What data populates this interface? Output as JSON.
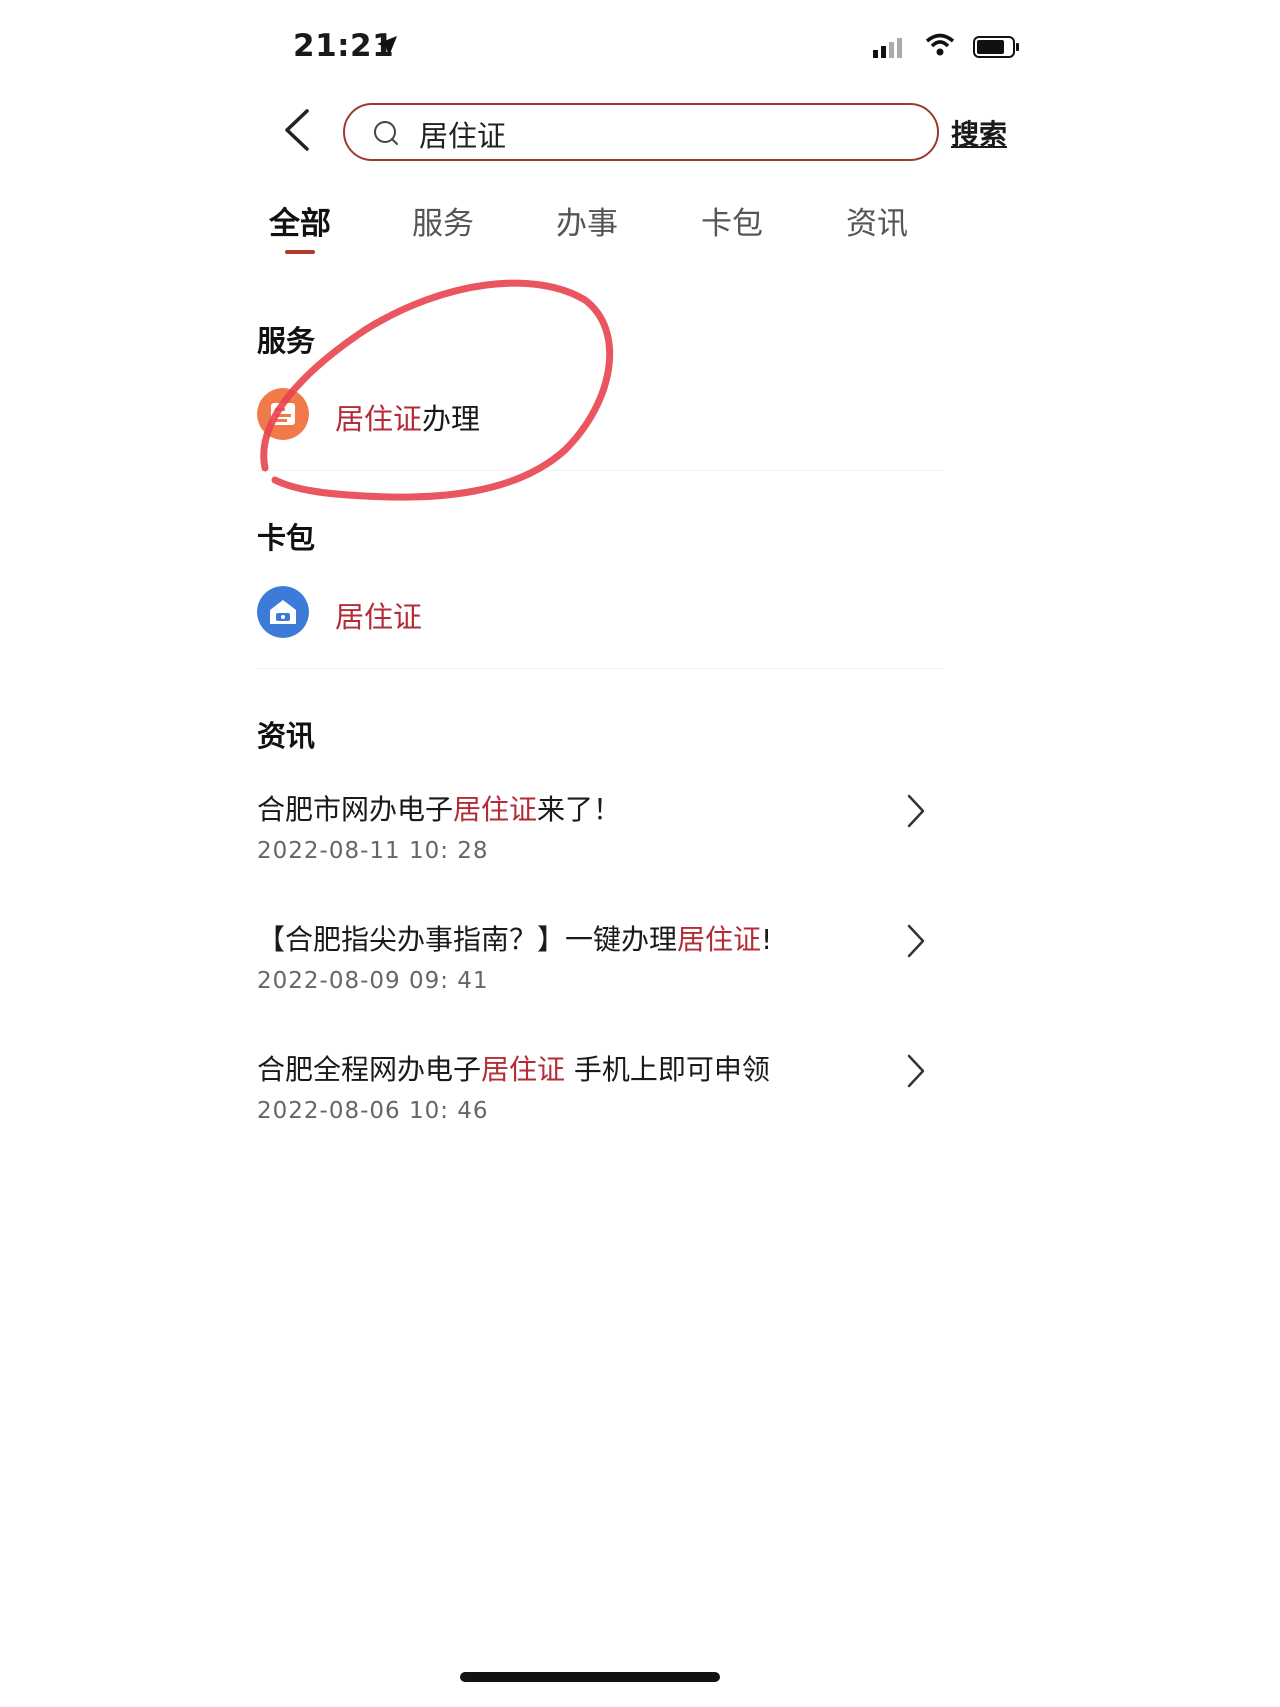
{
  "status_bar": {
    "time": "21:21"
  },
  "search": {
    "query": "居住证",
    "button_label": "搜索"
  },
  "tabs": [
    {
      "label": "全部",
      "active": true
    },
    {
      "label": "服务",
      "active": false
    },
    {
      "label": "办事",
      "active": false
    },
    {
      "label": "卡包",
      "active": false
    },
    {
      "label": "资讯",
      "active": false
    }
  ],
  "services": {
    "title": "服务",
    "item": {
      "highlight": "居住证",
      "rest": "办理",
      "icon": "document-icon"
    }
  },
  "cards": {
    "title": "卡包",
    "item": {
      "highlight": "居住证",
      "icon": "house-card-icon"
    }
  },
  "news": {
    "title": "资讯",
    "items": [
      {
        "pre": "合肥市网办电子",
        "hl": "居住证",
        "post": "来了！",
        "date": "2022-08-11 10: 28"
      },
      {
        "pre": "【合肥指尖办事指南？】一键办理",
        "hl": "居住证",
        "post": "!",
        "date": "2022-08-09 09: 41"
      },
      {
        "pre": "合肥全程网办电子",
        "hl": "居住证",
        "post": " 手机上即可申领",
        "date": "2022-08-06 10: 46"
      }
    ]
  },
  "colors": {
    "accent": "#b52b36",
    "annotation": "#e8444f",
    "card_icon": "#3d7bd9",
    "service_icon": "#f07a4a"
  }
}
